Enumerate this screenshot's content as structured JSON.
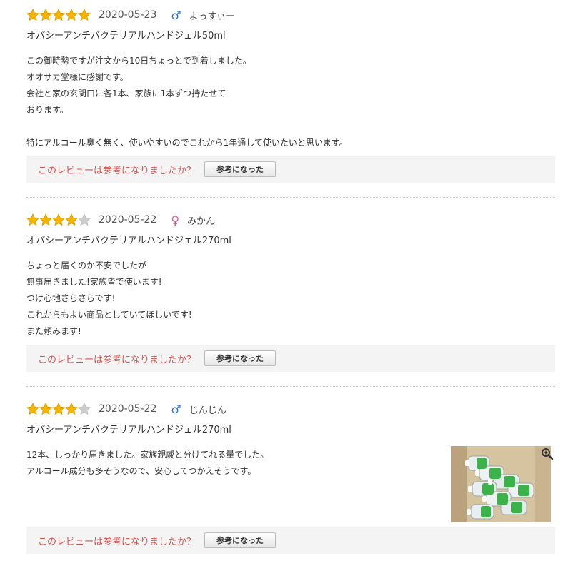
{
  "reviews": [
    {
      "rating": 5,
      "date": "2020-05-23",
      "gender": "male",
      "gender_symbol": "♂",
      "name": "よっすぃー",
      "product": "オパシーアンチバクテリアルハンドジェル50ml",
      "lines": [
        "この御時勢ですが注文から10日ちょっとで到着しました。",
        "オオサカ堂様に感謝です。",
        "会社と家の玄関口に各1本、家族に1本ずつ持たせて",
        "おります。",
        "",
        "特にアルコール臭く無く、使いやすいのでこれから1年通して使いたいと思います。"
      ],
      "helpful_question": "このレビューは参考になりましたか？",
      "helpful_button": "参考になった"
    },
    {
      "rating": 4,
      "date": "2020-05-22",
      "gender": "female",
      "gender_symbol": "♀",
      "name": "みかん",
      "product": "オパシーアンチバクテリアルハンドジェル270ml",
      "lines": [
        "ちょっと届くのか不安でしたが",
        "無事届きました!家族皆で使います!",
        "つけ心地さらさらです!",
        "これからもよい商品としていてほしいです!",
        "また頼みます!"
      ],
      "helpful_question": "このレビューは参考になりましたか？",
      "helpful_button": "参考になった"
    },
    {
      "rating": 4,
      "date": "2020-05-22",
      "gender": "male",
      "gender_symbol": "♂",
      "name": "じんじん",
      "product": "オパシーアンチバクテリアルハンドジェル270ml",
      "lines": [
        "12本、しっかり届きました。家族親戚と分けてれる量でした。",
        "アルコール成分も多そうなので、安心してつかえそうです。"
      ],
      "helpful_question": "このレビューは参考になりましたか？",
      "helpful_button": "参考になった",
      "has_photo": true,
      "photo_icon": "zoom-in-icon"
    }
  ],
  "colors": {
    "star_filled": "#f4b400",
    "star_empty": "#cccccc",
    "helpful_text": "#d9534f",
    "male": "#2a6fc9",
    "female": "#e0559a"
  }
}
